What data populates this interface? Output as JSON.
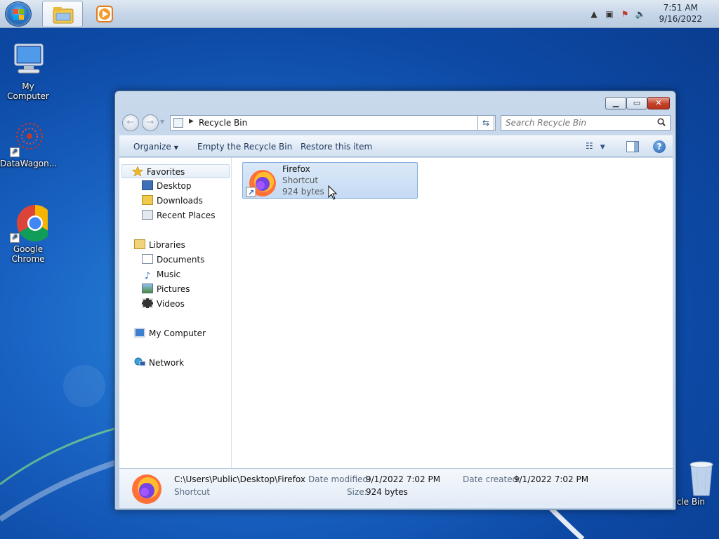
{
  "taskbar": {
    "clock_time": "7:51 AM",
    "clock_date": "9/16/2022"
  },
  "desktop": {
    "icons": [
      {
        "label": "My Computer",
        "icon": "computer-icon"
      },
      {
        "label": "DataWagon...",
        "icon": "datawagon-icon"
      },
      {
        "label": "Google Chrome",
        "icon": "chrome-icon"
      },
      {
        "label": "ycle Bin",
        "icon": "recycle-bin-icon"
      }
    ]
  },
  "window": {
    "address": {
      "crumb": "Recycle Bin"
    },
    "search": {
      "placeholder": "Search Recycle Bin"
    },
    "commands": {
      "organize": "Organize",
      "empty": "Empty the Recycle Bin",
      "restore": "Restore this item"
    },
    "nav": {
      "favorites": "Favorites",
      "desktop": "Desktop",
      "downloads": "Downloads",
      "recent": "Recent Places",
      "libraries": "Libraries",
      "documents": "Documents",
      "music": "Music",
      "pictures": "Pictures",
      "videos": "Videos",
      "computer": "My Computer",
      "network": "Network"
    },
    "file": {
      "name": "Firefox",
      "type": "Shortcut",
      "size": "924 bytes"
    },
    "details": {
      "path": "C:\\Users\\Public\\Desktop\\Firefox",
      "type": "Shortcut",
      "modified_label": "Date modified:",
      "modified_value": "9/1/2022 7:02 PM",
      "created_label": "Date created:",
      "created_value": "9/1/2022 7:02 PM",
      "size_label": "Size:",
      "size_value": "924 bytes"
    }
  },
  "colors": {
    "selection": "#c4daf3",
    "close_button": "#c4432a",
    "desktop_blue": "#1a64c4"
  }
}
